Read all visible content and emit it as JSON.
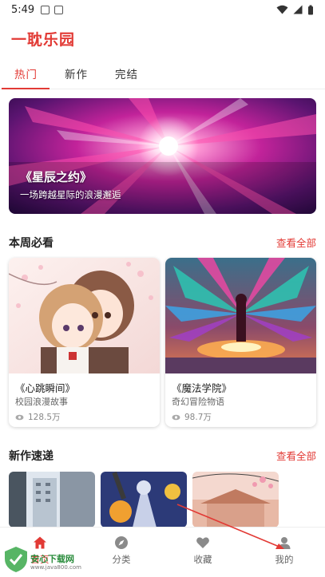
{
  "status_bar": {
    "time": "5:49"
  },
  "app": {
    "title": "一耽乐园"
  },
  "tabs": [
    {
      "label": "热门",
      "active": true
    },
    {
      "label": "新作",
      "active": false
    },
    {
      "label": "完结",
      "active": false
    }
  ],
  "banner": {
    "title": "《星辰之约》",
    "subtitle": "一场跨越星际的浪漫邂逅"
  },
  "weekly": {
    "title": "本周必看",
    "more": "查看全部",
    "cards": [
      {
        "title": "《心跳瞬间》",
        "subtitle": "校园浪漫故事",
        "views": "128.5万"
      },
      {
        "title": "《魔法学院》",
        "subtitle": "奇幻冒险物语",
        "views": "98.7万"
      }
    ]
  },
  "new_works": {
    "title": "新作速递",
    "more": "查看全部"
  },
  "bottom_nav": [
    {
      "label": "首页",
      "icon": "home-icon",
      "active": true
    },
    {
      "label": "分类",
      "icon": "compass-icon",
      "active": false
    },
    {
      "label": "收藏",
      "icon": "heart-icon",
      "active": false
    },
    {
      "label": "我的",
      "icon": "user-icon",
      "active": false
    }
  ],
  "watermark": {
    "text": "安心下载网",
    "url": "www.java800.com"
  },
  "colors": {
    "accent": "#e23a35",
    "watermark_green": "#2a8c3c"
  }
}
